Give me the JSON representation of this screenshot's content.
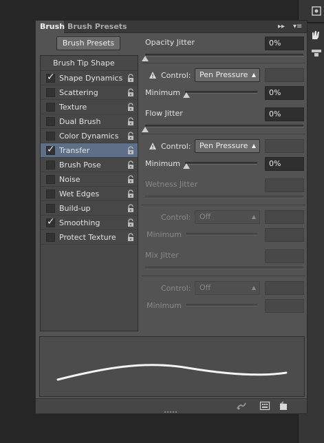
{
  "tabs": {
    "active": "Brush",
    "inactive": "Brush Presets"
  },
  "panel_menu": {
    "collapse": "▸▸",
    "menu": "▾≡"
  },
  "presets_button": "Brush Presets",
  "list": {
    "header": "Brush Tip Shape",
    "items": [
      {
        "label": "Shape Dynamics",
        "checked": true,
        "selected": false
      },
      {
        "label": "Scattering",
        "checked": false,
        "selected": false
      },
      {
        "label": "Texture",
        "checked": false,
        "selected": false
      },
      {
        "label": "Dual Brush",
        "checked": false,
        "selected": false
      },
      {
        "label": "Color Dynamics",
        "checked": false,
        "selected": false
      },
      {
        "label": "Transfer",
        "checked": true,
        "selected": true
      },
      {
        "label": "Brush Pose",
        "checked": false,
        "selected": false
      },
      {
        "label": "Noise",
        "checked": false,
        "selected": false
      },
      {
        "label": "Wet Edges",
        "checked": false,
        "selected": false
      },
      {
        "label": "Build-up",
        "checked": false,
        "selected": false
      },
      {
        "label": "Smoothing",
        "checked": true,
        "selected": false
      },
      {
        "label": "Protect Texture",
        "checked": false,
        "selected": false
      }
    ]
  },
  "opacity": {
    "title": "Opacity Jitter",
    "value": "0%",
    "control_label": "Control:",
    "control_value": "Pen Pressure",
    "min_label": "Minimum",
    "min_value": "0%"
  },
  "flow": {
    "title": "Flow Jitter",
    "value": "0%",
    "control_label": "Control:",
    "control_value": "Pen Pressure",
    "min_label": "Minimum",
    "min_value": "0%"
  },
  "wetness": {
    "title": "Wetness Jitter",
    "control_label": "Control:",
    "control_value": "Off",
    "min_label": "Minimum"
  },
  "mix": {
    "title": "Mix Jitter",
    "control_label": "Control:",
    "control_value": "Off",
    "min_label": "Minimum"
  },
  "colors": {
    "panel": "#535353",
    "selected_row": "#5e7088",
    "background": "#262626"
  }
}
